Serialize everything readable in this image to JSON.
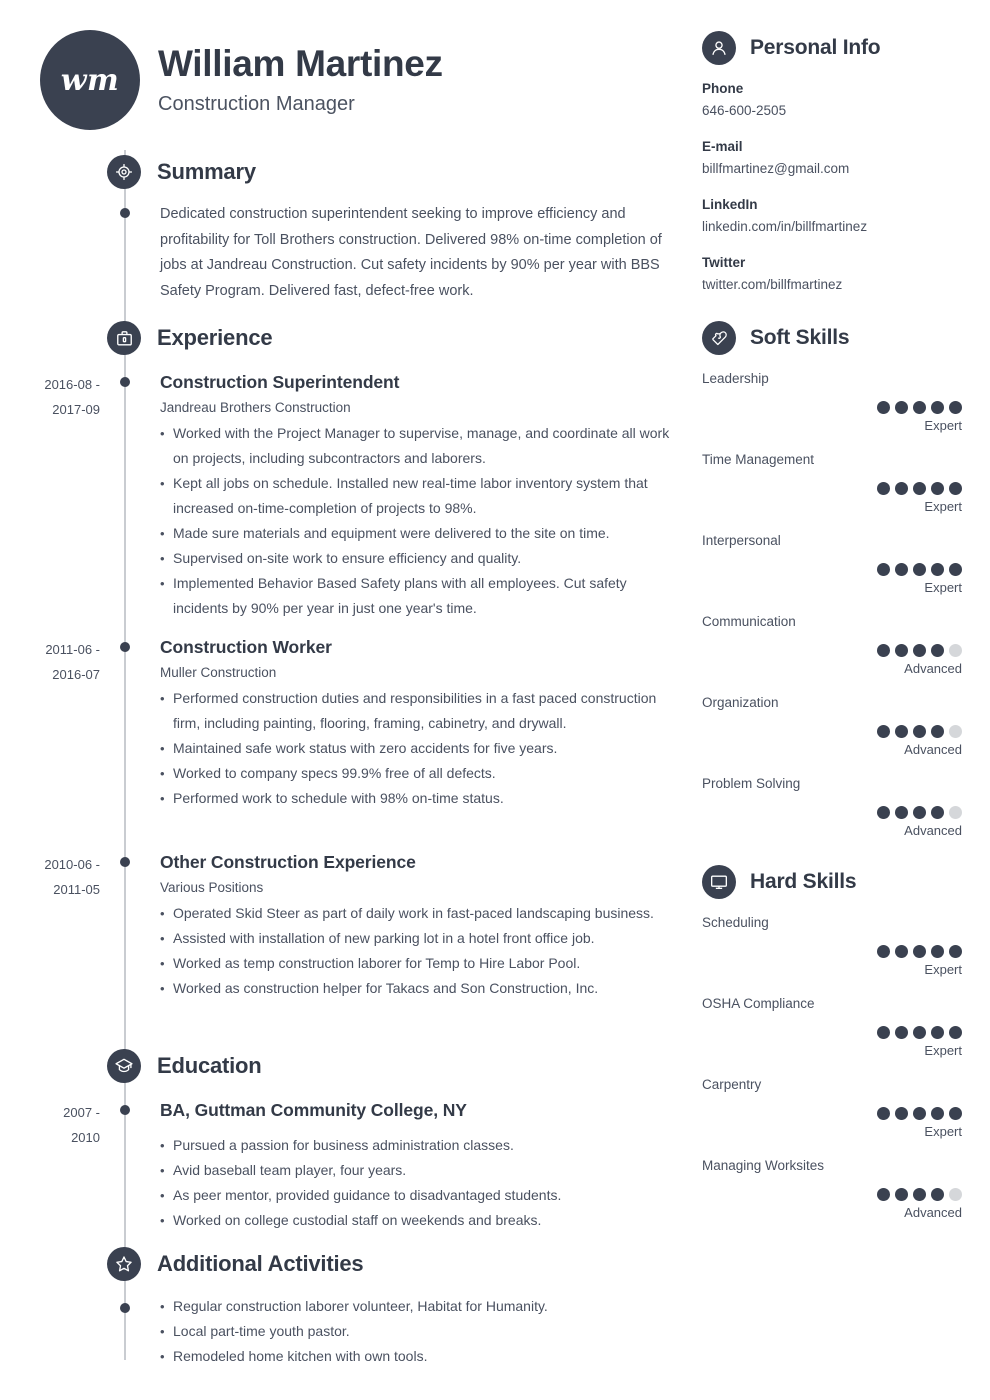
{
  "header": {
    "monogram": "wm",
    "name": "William Martinez",
    "title": "Construction Manager"
  },
  "colors": {
    "accent_dark": "#3a4150",
    "text": "#4a5160",
    "heading": "#333a47",
    "dot_off": "#d5d7da",
    "timeline": "#c9ccd1"
  },
  "sections": {
    "summary": {
      "heading": "Summary",
      "icon": "target-icon",
      "text": "Dedicated construction superintendent seeking to improve efficiency and profitability for Toll Brothers construction. Delivered 98% on-time completion of jobs at Jandreau Construction. Cut safety incidents by 90% per year with BBS Safety Program. Delivered fast, defect-free work."
    },
    "experience": {
      "heading": "Experience",
      "icon": "briefcase-icon",
      "entries": [
        {
          "date_from": "2016-08 -",
          "date_to": "2017-09",
          "title": "Construction Superintendent",
          "company": "Jandreau Brothers Construction",
          "bullets": [
            "Worked with the Project Manager to supervise, manage, and coordinate all work on projects, including subcontractors and laborers.",
            "Kept all jobs on schedule. Installed new real-time labor inventory system that increased on-time-completion of projects to 98%.",
            "Made sure materials and equipment were delivered to the site on time.",
            "Supervised on-site work to ensure efficiency and quality.",
            "Implemented Behavior Based Safety plans with all employees. Cut safety incidents by 90% per year in just one year's time."
          ]
        },
        {
          "date_from": "2011-06 -",
          "date_to": "2016-07",
          "title": "Construction Worker",
          "company": "Muller Construction",
          "bullets": [
            "Performed construction duties and responsibilities in a fast paced construction firm, including painting, flooring, framing, cabinetry, and drywall.",
            "Maintained safe work status with zero accidents for five years.",
            "Worked to company specs 99.9% free of all defects.",
            "Performed work to schedule with 98% on-time status."
          ]
        },
        {
          "date_from": "2010-06 -",
          "date_to": "2011-05",
          "title": "Other Construction Experience",
          "company": "Various Positions",
          "bullets": [
            "Operated Skid Steer as part of daily work in fast-paced landscaping business.",
            "Assisted with installation of new parking lot in a hotel front office job.",
            "Worked as temp construction laborer for Temp to Hire Labor Pool.",
            "Worked as construction helper for Takacs and Son Construction, Inc."
          ]
        }
      ]
    },
    "education": {
      "heading": "Education",
      "icon": "graduation-cap-icon",
      "entries": [
        {
          "date_from": "2007 -",
          "date_to": "2010",
          "title": "BA, Guttman Community College, NY",
          "bullets": [
            "Pursued a passion for business administration classes.",
            "Avid baseball team player, four years.",
            "As peer mentor, provided guidance to disadvantaged students.",
            "Worked on college custodial staff on weekends and breaks."
          ]
        }
      ]
    },
    "additional_activities": {
      "heading": "Additional Activities",
      "icon": "star-icon",
      "bullets": [
        "Regular construction laborer volunteer, Habitat for Humanity.",
        "Local part-time youth pastor.",
        "Remodeled home kitchen with own tools."
      ]
    },
    "personal_info": {
      "heading": "Personal Info",
      "icon": "person-icon",
      "items": [
        {
          "label": "Phone",
          "value": "646-600-2505"
        },
        {
          "label": "E-mail",
          "value": "billfmartinez@gmail.com"
        },
        {
          "label": "LinkedIn",
          "value": "linkedin.com/in/billfmartinez"
        },
        {
          "label": "Twitter",
          "value": "twitter.com/billfmartinez"
        }
      ]
    },
    "soft_skills": {
      "heading": "Soft Skills",
      "icon": "puzzle-heart-icon",
      "items": [
        {
          "name": "Leadership",
          "filled": 5,
          "total": 5,
          "level": "Expert"
        },
        {
          "name": "Time Management",
          "filled": 5,
          "total": 5,
          "level": "Expert"
        },
        {
          "name": "Interpersonal",
          "filled": 5,
          "total": 5,
          "level": "Expert"
        },
        {
          "name": "Communication",
          "filled": 4,
          "total": 5,
          "level": "Advanced"
        },
        {
          "name": "Organization",
          "filled": 4,
          "total": 5,
          "level": "Advanced"
        },
        {
          "name": "Problem Solving",
          "filled": 4,
          "total": 5,
          "level": "Advanced"
        }
      ]
    },
    "hard_skills": {
      "heading": "Hard Skills",
      "icon": "monitor-icon",
      "items": [
        {
          "name": "Scheduling",
          "filled": 5,
          "total": 5,
          "level": "Expert"
        },
        {
          "name": "OSHA Compliance",
          "filled": 5,
          "total": 5,
          "level": "Expert"
        },
        {
          "name": "Carpentry",
          "filled": 5,
          "total": 5,
          "level": "Expert"
        },
        {
          "name": "Managing Worksites",
          "filled": 4,
          "total": 5,
          "level": "Advanced"
        }
      ]
    }
  }
}
